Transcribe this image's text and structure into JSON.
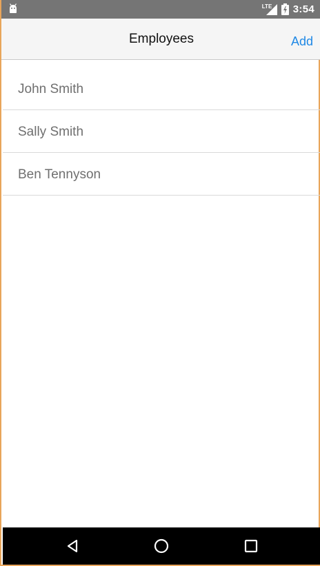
{
  "status_bar": {
    "time": "3:54",
    "network": "LTE",
    "icons": [
      "android-icon",
      "lte-signal-icon",
      "battery-icon"
    ]
  },
  "header": {
    "title": "Employees",
    "add_label": "Add"
  },
  "employees": [
    {
      "name": "John Smith"
    },
    {
      "name": "Sally Smith"
    },
    {
      "name": "Ben Tennyson"
    }
  ],
  "system_nav": {
    "icons": [
      "back-icon",
      "home-icon",
      "recents-icon"
    ]
  },
  "colors": {
    "status_bar": "#757575",
    "nav_bar": "#f5f5f5",
    "accent": "#1e88e5",
    "item_text": "#6f6f6f",
    "frame_border": "#e8a55a"
  }
}
